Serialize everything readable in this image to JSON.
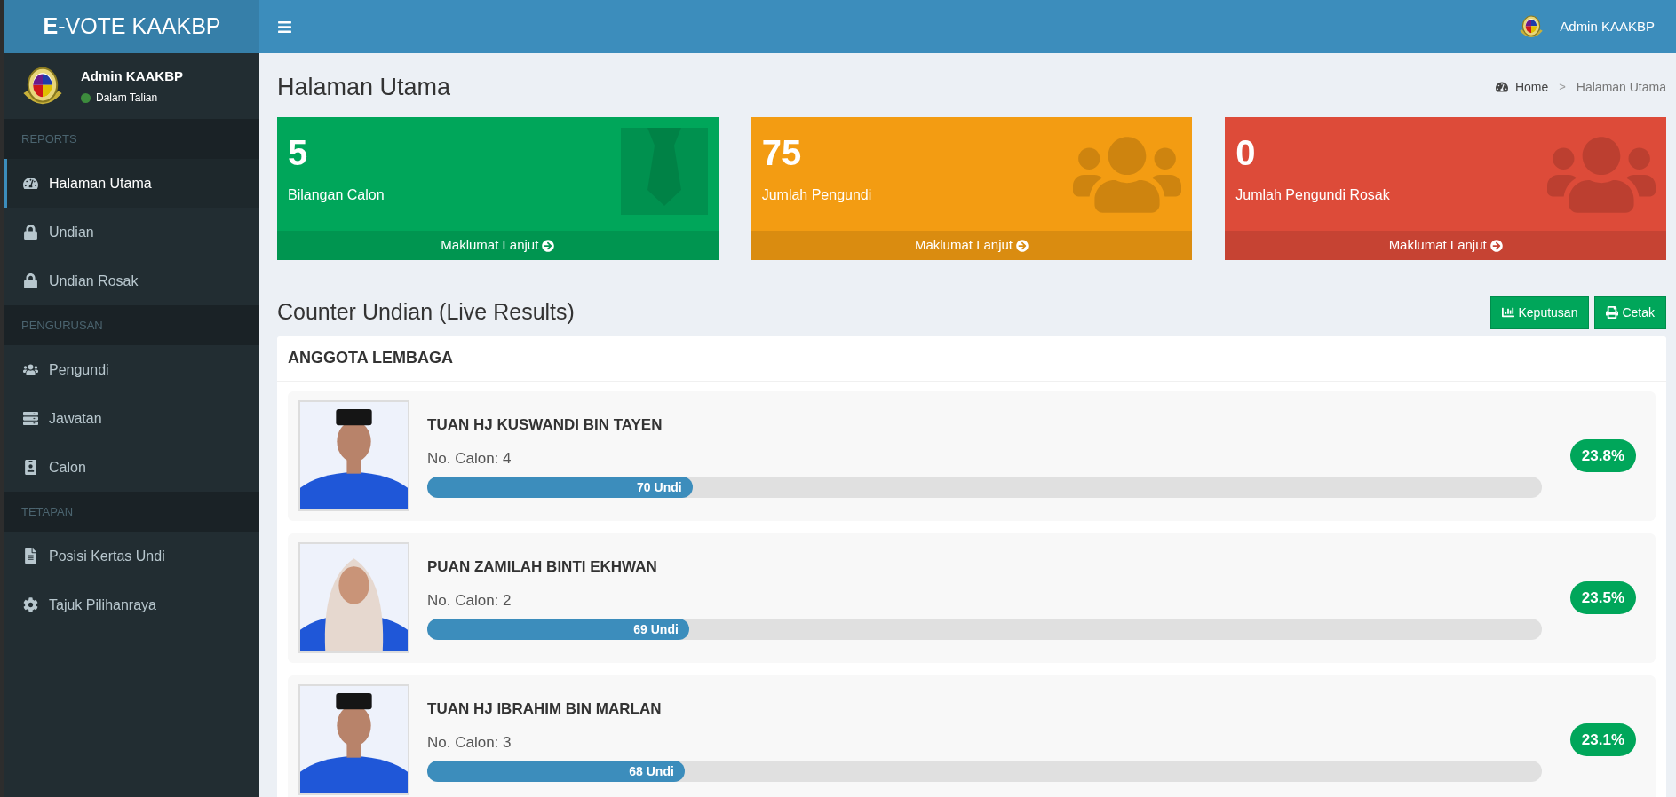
{
  "brand": "**E**-VOTE KAAKBP",
  "header": {
    "user": "Admin KAAKBP"
  },
  "sidebar": {
    "user": {
      "name": "Admin KAAKBP",
      "status": "Dalam Talian"
    },
    "sections": [
      {
        "label": "REPORTS",
        "items": [
          {
            "label": "Halaman Utama",
            "selected": true
          },
          {
            "label": "Undian",
            "selected": false
          },
          {
            "label": "Undian Rosak",
            "selected": false
          }
        ]
      },
      {
        "label": "PENGURUSAN",
        "items": [
          {
            "label": "Pengundi",
            "selected": false
          },
          {
            "label": "Jawatan",
            "selected": false
          },
          {
            "label": "Calon",
            "selected": false
          }
        ]
      },
      {
        "label": "TETAPAN",
        "items": [
          {
            "label": "Posisi Kertas Undi",
            "selected": false
          },
          {
            "label": "Tajuk Pilihanraya",
            "selected": false
          }
        ]
      }
    ]
  },
  "page_title": "Halaman Utama",
  "breadcrumb": [
    "Home",
    "Halaman Utama"
  ],
  "breadcrumb_separator": ">",
  "cards": [
    {
      "value": "5",
      "label": "Bilangan Calon",
      "link": "Maklumat Lanjut",
      "color": "#00a65a"
    },
    {
      "value": "75",
      "label": "Jumlah Pengundi",
      "link": "Maklumat Lanjut",
      "color": "#f39c12"
    },
    {
      "value": "0",
      "label": "Jumlah Pengundi Rosak",
      "link": "Maklumat Lanjut",
      "color": "#dd4b39"
    }
  ],
  "section": {
    "title": "Counter Undian (Live Results)",
    "buttons": [
      "Keputusan",
      "Cetak"
    ]
  },
  "panel": {
    "title": "ANGGOTA LEMBAGA",
    "candidates": [
      {
        "name": "TUAN HJ KUSWANDI BIN TAYEN",
        "number": "No. Calon: 4",
        "votes": "70 Undi",
        "level": 0.238,
        "percent": "23.8%"
      },
      {
        "name": "PUAN ZAMILAH BINTI EKHWAN",
        "number": "No. Calon: 2",
        "votes": "69 Undi",
        "level": 0.235,
        "percent": "23.5%"
      },
      {
        "name": "TUAN HJ IBRAHIM BIN MARLAN",
        "number": "No. Calon: 3",
        "votes": "68 Undi",
        "level": 0.231,
        "percent": "23.1%"
      }
    ]
  }
}
